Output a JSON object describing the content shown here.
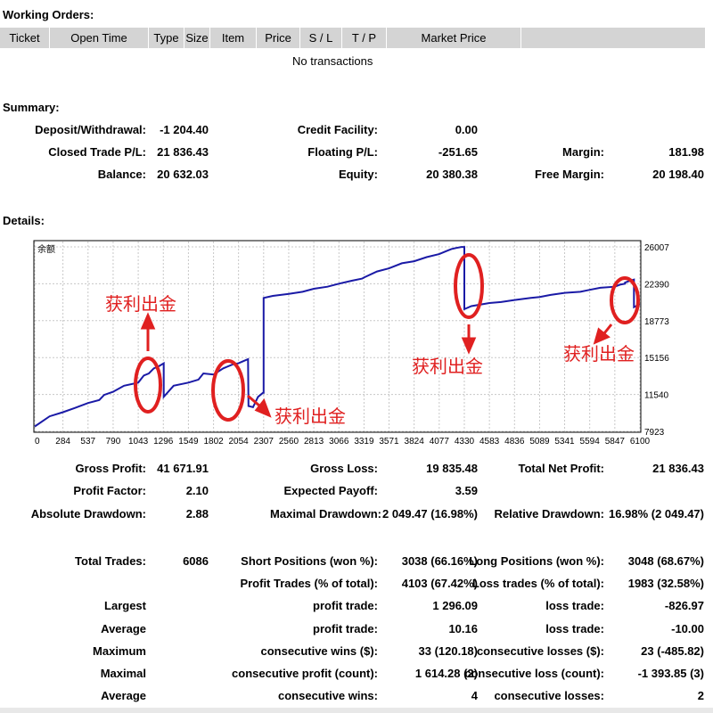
{
  "working_orders": {
    "title": "Working Orders:",
    "columns": [
      "Ticket",
      "Open Time",
      "Type",
      "Size",
      "Item",
      "Price",
      "S / L",
      "T / P",
      "Market Price",
      ""
    ],
    "empty_text": "No transactions"
  },
  "summary": {
    "title": "Summary:",
    "deposit_label": "Deposit/Withdrawal:",
    "deposit_value": "-1 204.40",
    "credit_label": "Credit Facility:",
    "credit_value": "0.00",
    "closed_label": "Closed Trade P/L:",
    "closed_value": "21 836.43",
    "floating_label": "Floating P/L:",
    "floating_value": "-251.65",
    "margin_label": "Margin:",
    "margin_value": "181.98",
    "balance_label": "Balance:",
    "balance_value": "20 632.03",
    "equity_label": "Equity:",
    "equity_value": "20 380.38",
    "free_margin_label": "Free Margin:",
    "free_margin_value": "20 198.40"
  },
  "details": {
    "title": "Details:"
  },
  "chart_data": {
    "type": "line",
    "title": "余额",
    "x_ticks": [
      "0",
      "284",
      "537",
      "790",
      "1043",
      "1296",
      "1549",
      "1802",
      "2054",
      "2307",
      "2560",
      "2813",
      "3066",
      "3319",
      "3571",
      "3824",
      "4077",
      "4330",
      "4583",
      "4836",
      "5089",
      "5341",
      "5594",
      "5847",
      "6100"
    ],
    "y_ticks": [
      "26007",
      "22390",
      "18773",
      "15156",
      "11540",
      "7923"
    ],
    "ylim": [
      7923,
      26007
    ],
    "xlim": [
      0,
      6100
    ],
    "grid": true,
    "line_color": "#1a1aa6",
    "series": [
      {
        "x": [
          0,
          150,
          284,
          400,
          537,
          650,
          700,
          790,
          900,
          1043,
          1100,
          1150,
          1200,
          1250,
          1300,
          1300,
          1400,
          1549,
          1650,
          1700,
          1802,
          1900,
          2000,
          2054,
          2100,
          2150,
          2154,
          2200,
          2250,
          2300,
          2307,
          2307,
          2400,
          2560,
          2700,
          2813,
          2950,
          3066,
          3200,
          3300,
          3319,
          3450,
          3571,
          3700,
          3824,
          3950,
          4077,
          4150,
          4200,
          4250,
          4300,
          4330,
          4330,
          4400,
          4583,
          4700,
          4836,
          5000,
          5089,
          5200,
          5341,
          5500,
          5594,
          5700,
          5847,
          5900,
          5950,
          5950,
          6000,
          6040,
          6040,
          6100
        ],
        "y": [
          8400,
          9400,
          9800,
          10200,
          10700,
          11000,
          11500,
          11800,
          12400,
          12700,
          13400,
          13600,
          14100,
          14300,
          14600,
          11300,
          12400,
          12700,
          13000,
          13600,
          13500,
          14100,
          14500,
          14600,
          14800,
          15000,
          10400,
          10300,
          11300,
          11700,
          11700,
          21000,
          21200,
          21400,
          21600,
          21900,
          22100,
          22400,
          22700,
          22900,
          23000,
          23600,
          23900,
          24400,
          24600,
          25000,
          25300,
          25600,
          25800,
          25900,
          26000,
          26000,
          19900,
          20200,
          20500,
          20600,
          20800,
          21000,
          21100,
          21300,
          21500,
          21600,
          21800,
          22000,
          22100,
          22300,
          22400,
          22500,
          22700,
          22800,
          20100,
          20400
        ]
      }
    ],
    "annotations": [
      "获利出金",
      "获利出金",
      "获利出金",
      "获利出金"
    ],
    "annotation_color": "#e02020"
  },
  "stats": {
    "gross_profit_label": "Gross Profit:",
    "gross_profit_value": "41 671.91",
    "gross_loss_label": "Gross Loss:",
    "gross_loss_value": "19 835.48",
    "total_net_label": "Total Net Profit:",
    "total_net_value": "21 836.43",
    "profit_factor_label": "Profit Factor:",
    "profit_factor_value": "2.10",
    "expected_payoff_label": "Expected Payoff:",
    "expected_payoff_value": "3.59",
    "abs_dd_label": "Absolute Drawdown:",
    "abs_dd_value": "2.88",
    "max_dd_label": "Maximal Drawdown:",
    "max_dd_value": "2 049.47 (16.98%)",
    "rel_dd_label": "Relative Drawdown:",
    "rel_dd_value": "16.98% (2 049.47)",
    "total_trades_label": "Total Trades:",
    "total_trades_value": "6086",
    "short_label": "Short Positions (won %):",
    "short_value": "3038 (66.16%)",
    "long_label": "Long Positions (won %):",
    "long_value": "3048 (68.67%)",
    "profit_trades_label": "Profit Trades (% of total):",
    "profit_trades_value": "4103 (67.42%)",
    "loss_trades_label": "Loss trades (% of total):",
    "loss_trades_value": "1983 (32.58%)",
    "largest_label": "Largest",
    "largest_profit_label": "profit trade:",
    "largest_profit_value": "1 296.09",
    "largest_loss_label": "loss trade:",
    "largest_loss_value": "-826.97",
    "average_label": "Average",
    "average_profit_label": "profit trade:",
    "average_profit_value": "10.16",
    "average_loss_label": "loss trade:",
    "average_loss_value": "-10.00",
    "maximum_label": "Maximum",
    "max_wins_label": "consecutive wins ($):",
    "max_wins_value": "33 (120.18)",
    "max_losses_label": "consecutive losses ($):",
    "max_losses_value": "23 (-485.82)",
    "maximal_label": "Maximal",
    "maximal_profit_label": "consecutive profit (count):",
    "maximal_profit_value": "1 614.28 (2)",
    "maximal_loss_label": "consecutive loss (count):",
    "maximal_loss_value": "-1 393.85 (3)",
    "average2_label": "Average",
    "avg_wins_label": "consecutive wins:",
    "avg_wins_value": "4",
    "avg_losses_label": "consecutive losses:",
    "avg_losses_value": "2"
  }
}
